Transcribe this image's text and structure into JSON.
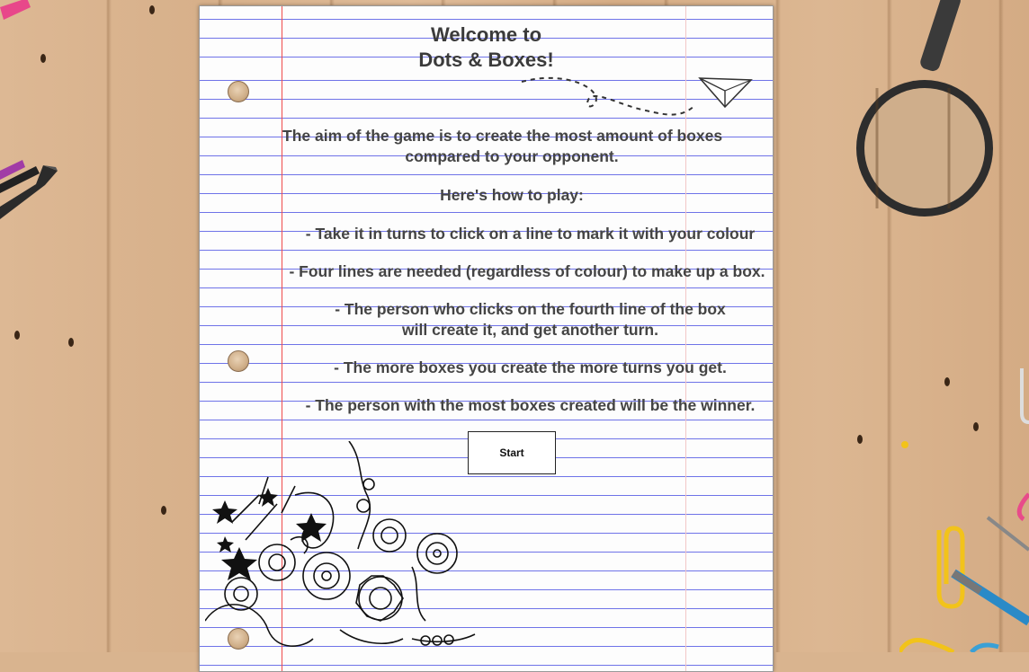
{
  "title": {
    "line1": "Welcome to",
    "line2": "Dots & Boxes!"
  },
  "instructions": {
    "aim_line1": "The aim of the game is to create the most amount of boxes",
    "aim_line2": "compared to your opponent.",
    "how_to": "Here's how to play:",
    "rule1": "- Take it in turns to click on a line to mark it with your colour",
    "rule2": "- Four lines are needed (regardless of colour) to make up a box.",
    "rule3_line1": "- The person who clicks on the fourth line of the box",
    "rule3_line2": "will create it, and get another turn.",
    "rule4": "- The more boxes you create the more turns you get.",
    "rule5": "- The person with the most boxes created will be the winner."
  },
  "start_button": {
    "label": "Start"
  },
  "colors": {
    "paper": "#fdfdfd",
    "ruled_line": "#6f73e8",
    "margin_line": "#ef4b4b",
    "text": "#444444",
    "desk": "#d9b48f"
  },
  "icons": [
    "paper-plane-icon",
    "magnifying-glass-icon",
    "flower-doodle-icon",
    "star-icon",
    "marker-icon",
    "paperclip-icon"
  ]
}
